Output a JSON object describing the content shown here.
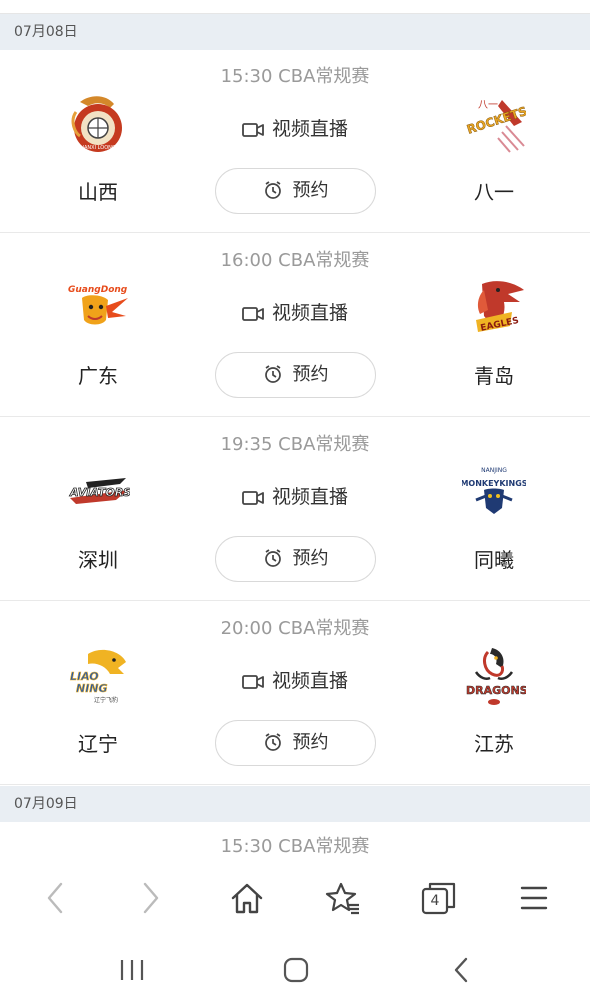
{
  "days": [
    {
      "date": "07月08日",
      "matches": [
        {
          "info": "15:30 CBA常规赛",
          "home": "山西",
          "away": "八一",
          "live_label": "视频直播",
          "reserve_label": "预约"
        },
        {
          "info": "16:00 CBA常规赛",
          "home": "广东",
          "away": "青岛",
          "live_label": "视频直播",
          "reserve_label": "预约"
        },
        {
          "info": "19:35 CBA常规赛",
          "home": "深圳",
          "away": "同曦",
          "live_label": "视频直播",
          "reserve_label": "预约"
        },
        {
          "info": "20:00 CBA常规赛",
          "home": "辽宁",
          "away": "江苏",
          "live_label": "视频直播",
          "reserve_label": "预约"
        }
      ]
    },
    {
      "date": "07月09日",
      "matches": [
        {
          "info": "15:30 CBA常规赛"
        }
      ]
    }
  ],
  "logos": {
    "m0_home_text": "SHANXI LOONGS",
    "m0_away_text": "ROCKETS",
    "m0_away_small": "八一",
    "m1_home_text": "GuangDong",
    "m1_away_text": "EAGLES",
    "m2_home_text": "AVIATORS",
    "m3_home_text": "LIAO NING",
    "m3_home_small": "辽宁飞豹",
    "m2_away_top": "NANJING",
    "m2_away_text": "MONKEYKINGS",
    "m3_away_text": "DRAGONS"
  },
  "browser_toolbar": {
    "tabs_count": "4"
  },
  "colors": {
    "date_header_bg": "#e9eef3",
    "muted_text": "#9a9a9a",
    "icon": "#444444"
  }
}
